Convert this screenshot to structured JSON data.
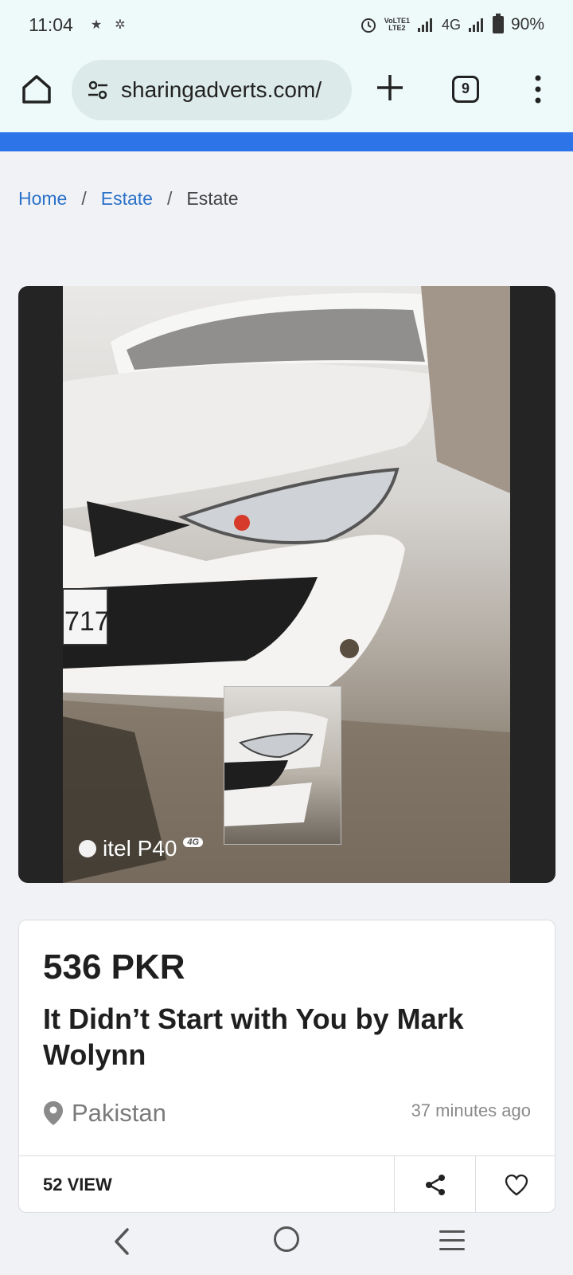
{
  "status_bar": {
    "time": "11:04",
    "left_icons": [
      "star-icon",
      "gear-small-icon"
    ],
    "volte": "VoLTE1",
    "lte": "LTE2",
    "network": "4G",
    "battery": "90%"
  },
  "browser": {
    "url": "sharingadverts.com/",
    "tab_count": "9",
    "accent": "#2d74e8"
  },
  "breadcrumb": {
    "items": [
      {
        "label": "Home",
        "link": true
      },
      {
        "label": "Estate",
        "link": true
      },
      {
        "label": "Estate",
        "link": false
      }
    ],
    "separator": "/"
  },
  "gallery": {
    "watermark_text": "itel P40",
    "watermark_badge": "4G",
    "plate_text": "717"
  },
  "listing": {
    "price": "536 PKR",
    "title": "It Didn’t Start with You by Mark Wolynn",
    "location": "Pakistan",
    "posted": "37 minutes ago",
    "views": "52 VIEW"
  }
}
